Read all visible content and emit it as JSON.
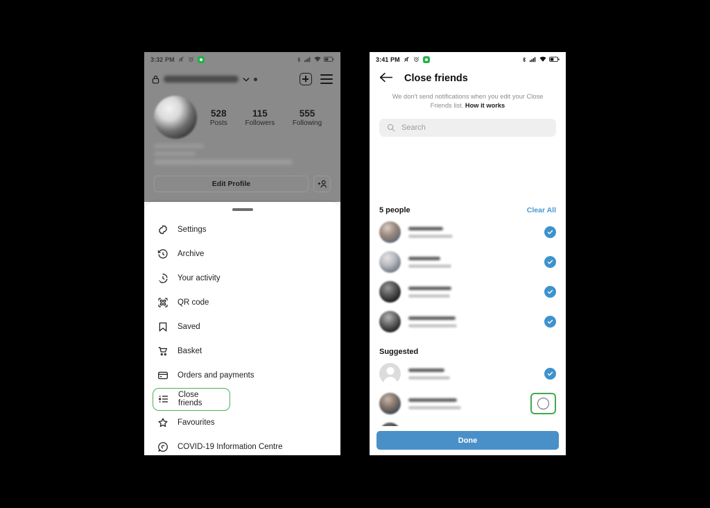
{
  "meta": {
    "background": "#000000",
    "accent_blue": "#4a90c8",
    "highlight_green": "#3faa4c"
  },
  "left_phone": {
    "status_bar": {
      "time": "3:32 PM",
      "left_icons": [
        "mute-icon",
        "alarm-icon",
        "green-app-icon"
      ],
      "right_icons": [
        "bluetooth-icon",
        "signal-icon",
        "wifi-icon",
        "battery-icon"
      ]
    },
    "profile": {
      "lock_icon": "lock-icon",
      "username_redacted": true,
      "chevron_icon": "chevron-down-icon",
      "new_post_icon": "square-plus-icon",
      "menu_icon": "hamburger-menu-icon",
      "stats": [
        {
          "number": "528",
          "label": "Posts"
        },
        {
          "number": "115",
          "label": "Followers"
        },
        {
          "number": "555",
          "label": "Following"
        }
      ],
      "edit_profile_label": "Edit Profile",
      "add_person_icon": "add-person-icon"
    },
    "sheet": {
      "items": [
        {
          "icon": "settings-gear-icon",
          "label": "Settings",
          "highlighted": false
        },
        {
          "icon": "archive-clock-icon",
          "label": "Archive",
          "highlighted": false
        },
        {
          "icon": "your-activity-clock-icon",
          "label": "Your activity",
          "highlighted": false
        },
        {
          "icon": "qr-code-icon",
          "label": "QR code",
          "highlighted": false
        },
        {
          "icon": "bookmark-saved-icon",
          "label": "Saved",
          "highlighted": false
        },
        {
          "icon": "shopping-basket-icon",
          "label": "Basket",
          "highlighted": false
        },
        {
          "icon": "credit-card-icon",
          "label": "Orders and payments",
          "highlighted": false
        },
        {
          "icon": "close-friends-list-icon",
          "label": "Close friends",
          "highlighted": true
        },
        {
          "icon": "star-favourites-icon",
          "label": "Favourites",
          "highlighted": false
        },
        {
          "icon": "covid-info-icon",
          "label": "COVID-19 Information Centre",
          "highlighted": false
        }
      ]
    }
  },
  "right_phone": {
    "status_bar": {
      "time": "3:41 PM",
      "left_icons": [
        "mute-icon",
        "alarm-icon",
        "green-app-icon"
      ],
      "right_icons": [
        "bluetooth-icon",
        "signal-icon",
        "wifi-icon",
        "battery-icon"
      ]
    },
    "topbar": {
      "back_icon": "back-arrow-icon",
      "title": "Close friends"
    },
    "note": {
      "text": "We don't send notifications when you edit your Close Friends list. ",
      "link": "How it works"
    },
    "search": {
      "icon": "search-icon",
      "placeholder": "Search",
      "value": ""
    },
    "sections": [
      {
        "title": "5 people",
        "action": "Clear All",
        "rows": [
          {
            "avatar": "g1",
            "name_redacted": true,
            "selected": true,
            "boxed": false
          },
          {
            "avatar": "g2",
            "name_redacted": true,
            "selected": true,
            "boxed": false
          },
          {
            "avatar": "g3",
            "name_redacted": true,
            "selected": true,
            "boxed": false
          },
          {
            "avatar": "g4",
            "name_redacted": true,
            "selected": true,
            "boxed": false
          }
        ]
      },
      {
        "title": "Suggested",
        "action": "",
        "rows": [
          {
            "avatar": "generic",
            "name_redacted": true,
            "selected": true,
            "boxed": false
          },
          {
            "avatar": "g6",
            "name_redacted": true,
            "selected": false,
            "boxed": true
          },
          {
            "avatar": "g5",
            "name_redacted": true,
            "selected": false,
            "boxed": false
          },
          {
            "avatar": "g3",
            "name_redacted": true,
            "selected": false,
            "boxed": false
          }
        ]
      }
    ],
    "done_button_label": "Done"
  }
}
